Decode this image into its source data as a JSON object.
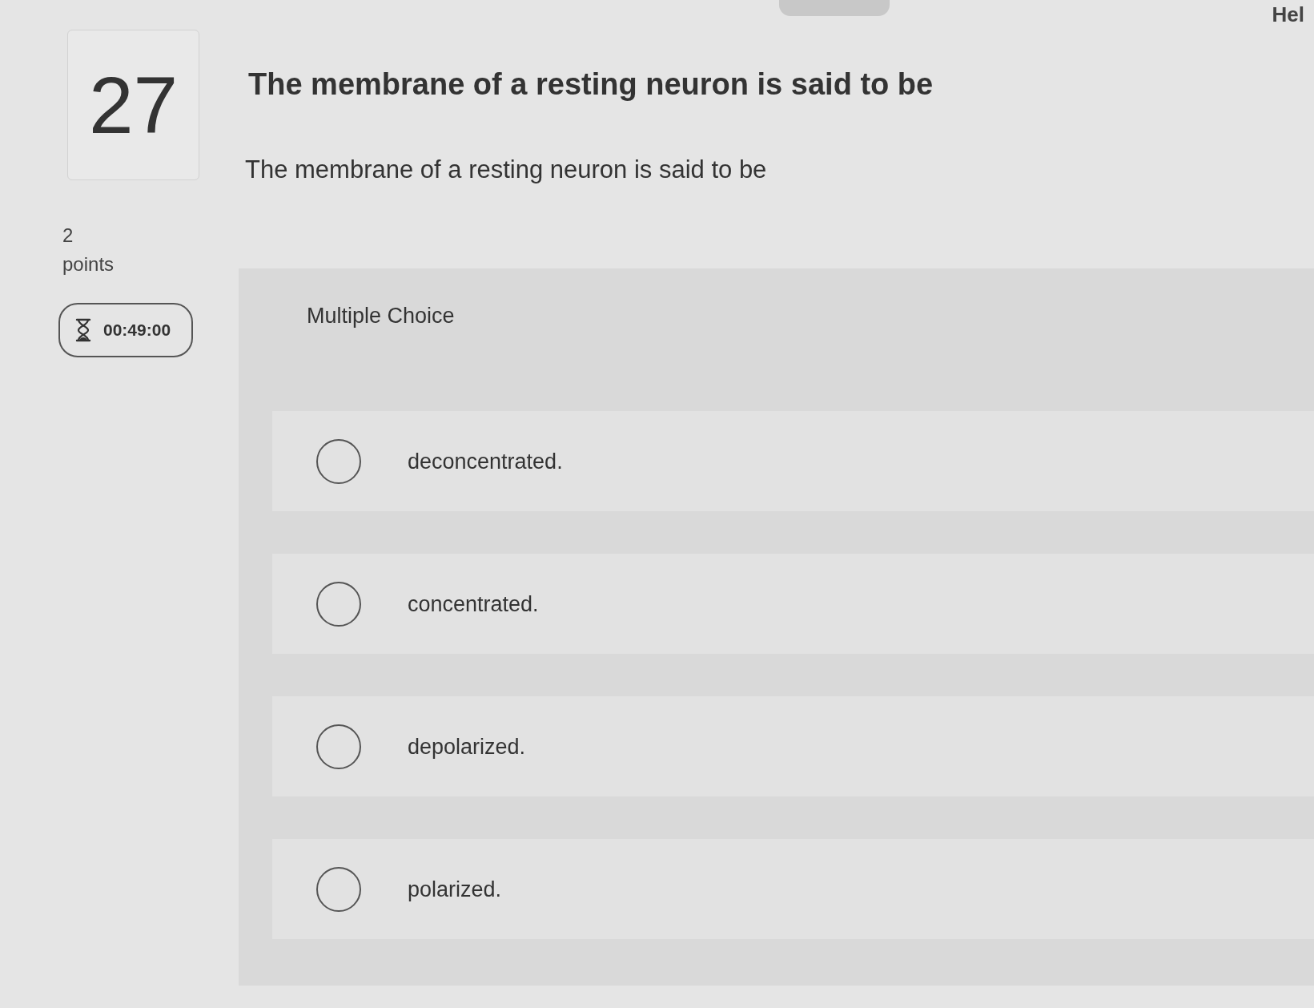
{
  "header": {
    "help_link": "Hel"
  },
  "question": {
    "number": "27",
    "title": "The membrane of a resting neuron is said to be",
    "prompt": "The membrane of a resting neuron is said to be",
    "points_value": "2",
    "points_label": "points",
    "timer": "00:49:00"
  },
  "answer_panel": {
    "type_label": "Multiple Choice",
    "options": [
      {
        "text": "deconcentrated.",
        "selected": false
      },
      {
        "text": "concentrated.",
        "selected": false
      },
      {
        "text": "depolarized.",
        "selected": false
      },
      {
        "text": "polarized.",
        "selected": false
      }
    ]
  }
}
